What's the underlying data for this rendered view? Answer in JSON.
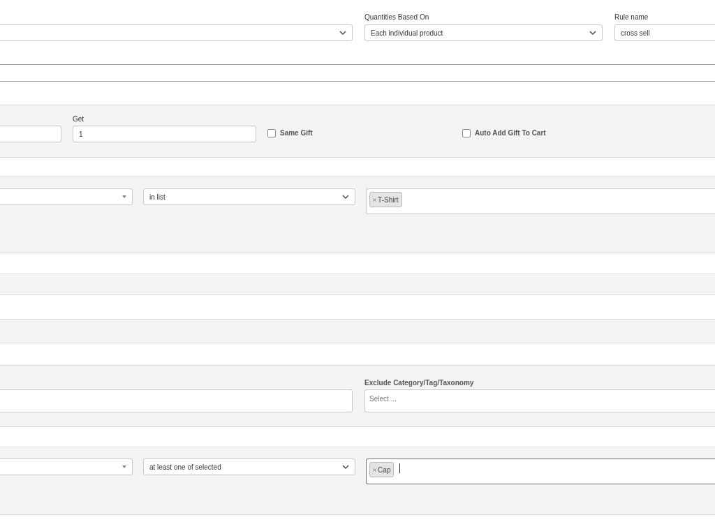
{
  "top": {
    "quantities": {
      "label": "Quantities Based On",
      "value": "Each individual product"
    },
    "rule_name": {
      "label": "Rule name",
      "value": "cross sell"
    }
  },
  "gift": {
    "get": {
      "label": "Get",
      "value": "1"
    },
    "options": [
      {
        "label": "Same Gift",
        "checked": false
      },
      {
        "label": "Auto Add Gift To Cart",
        "checked": false
      }
    ]
  },
  "condition_1": {
    "operator": "in list",
    "tags": [
      "T-Shirt"
    ],
    "focused": false
  },
  "exclude": {
    "label": "Exclude Category/Tag/Taxonomy",
    "placeholder": "Select ..."
  },
  "condition_2": {
    "operator": "at least one of selected",
    "tags": [
      "Cap"
    ],
    "focused": true
  }
}
